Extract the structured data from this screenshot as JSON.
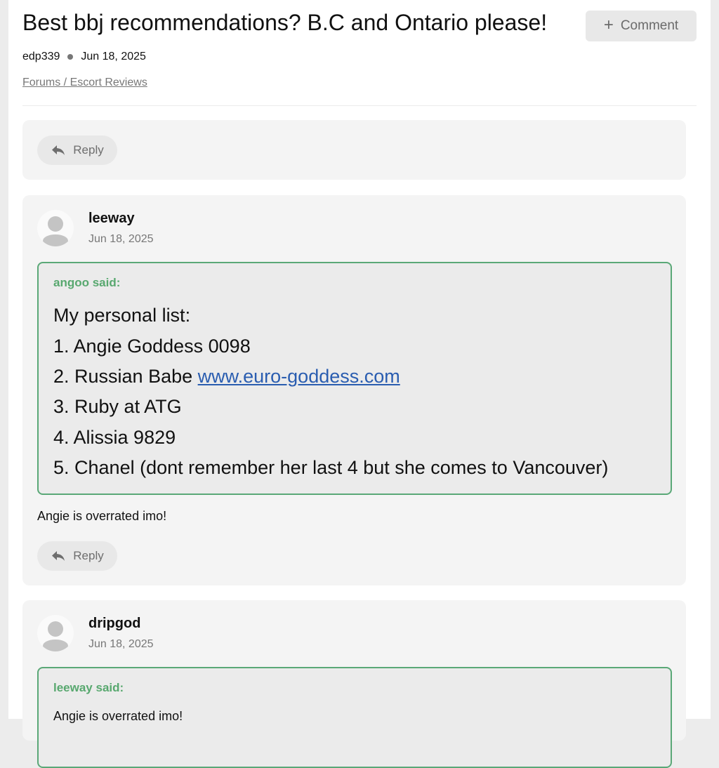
{
  "thread": {
    "title": "Best bbj recommendations? B.C and Ontario please!",
    "author": "edp339",
    "date": "Jun 18, 2025",
    "breadcrumb": "Forums / Escort Reviews",
    "comment_label": "Comment"
  },
  "reply_label": "Reply",
  "posts": [
    {
      "username": "leeway",
      "date": "Jun 18, 2025",
      "quote": {
        "author": "angoo said:",
        "lines": [
          "My personal list:",
          "1. Angie Goddess 0098",
          "2. Russian Babe ",
          "3. Ruby at ATG",
          "4. Alissia 9829",
          "5. Chanel (dont remember her last 4 but she comes to Vancouver)"
        ],
        "link": "www.euro-goddess.com"
      },
      "body": "Angie is overrated imo!"
    },
    {
      "username": "dripgod",
      "date": "Jun 18, 2025",
      "quote": {
        "author": "leeway said:",
        "lines": [
          "Angie is overrated imo!"
        ]
      }
    }
  ],
  "icons": {
    "comment": "plus-icon",
    "reply": "reply-arrow-icon",
    "avatar": "user-avatar-icon"
  },
  "colors": {
    "quote_border": "#5aa877",
    "quote_author": "#58a86f",
    "link": "#2a5db0",
    "post_background": "#f4f4f4"
  }
}
